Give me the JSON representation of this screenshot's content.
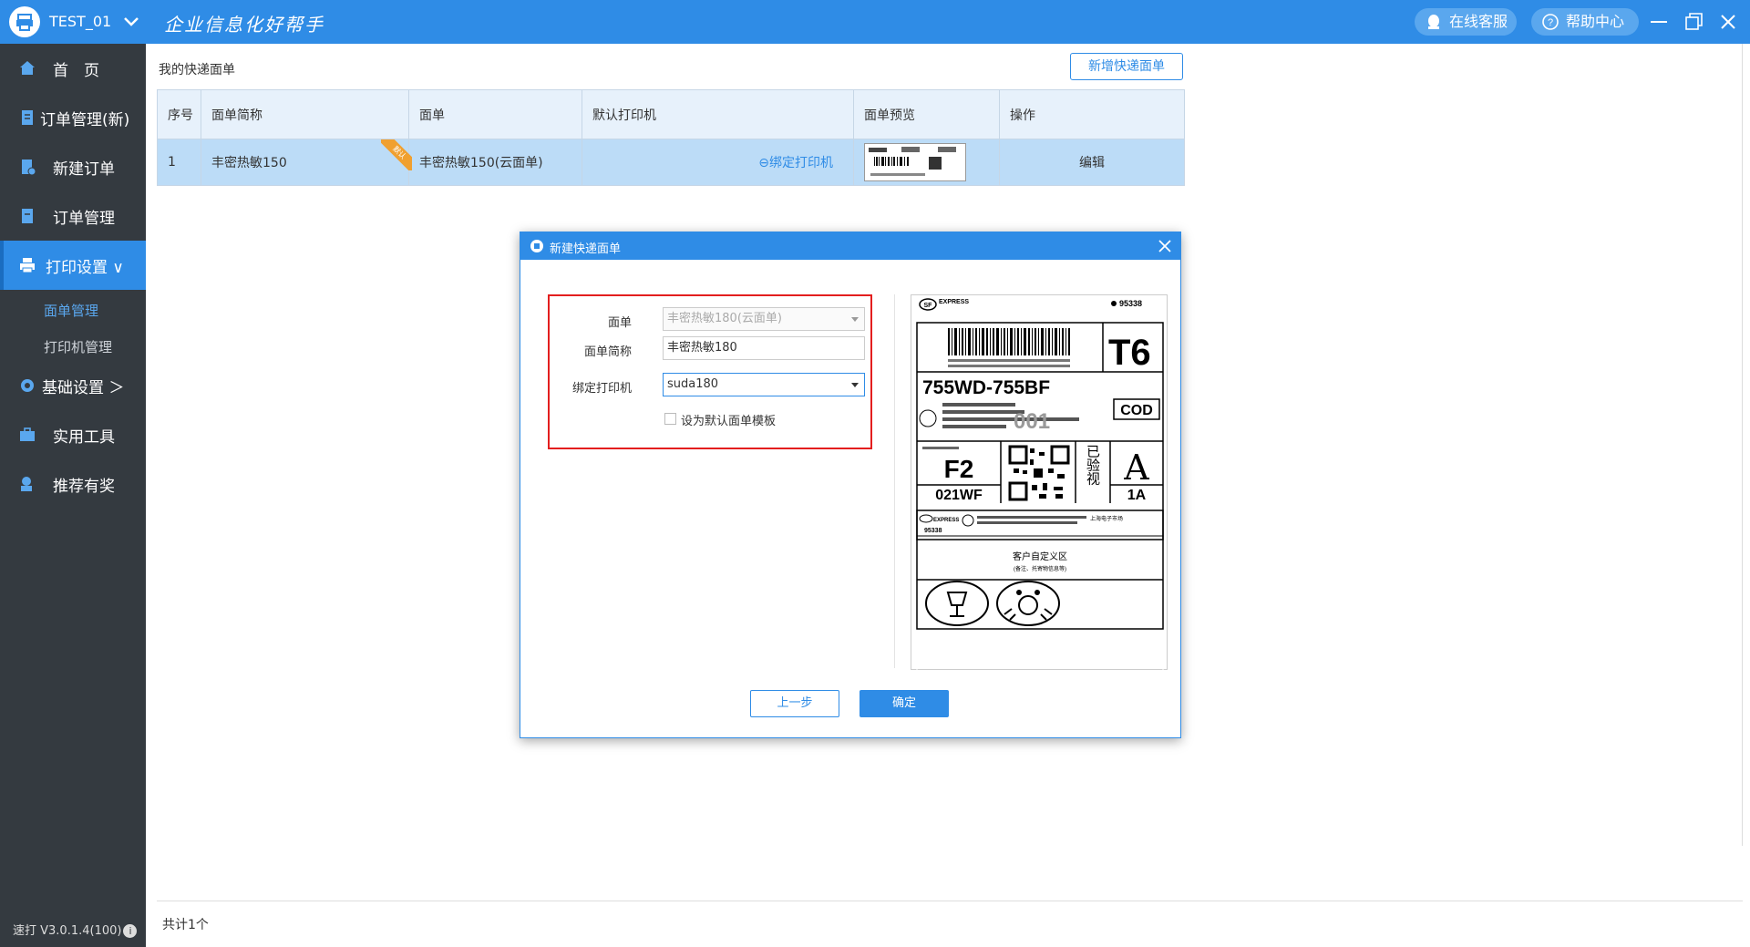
{
  "titlebar": {
    "app_name": "TEST_01",
    "slogan": "企业信息化好帮手",
    "service": "在线客服",
    "help": "帮助中心"
  },
  "sidebar": {
    "items": [
      {
        "label": "首　页",
        "icon": "home-icon"
      },
      {
        "label": "订单管理(新)",
        "icon": "order-new-icon"
      },
      {
        "label": "新建订单",
        "icon": "new-order-icon"
      },
      {
        "label": "订单管理",
        "icon": "order-icon"
      },
      {
        "label": "打印设置 ∨",
        "icon": "printer-icon"
      },
      {
        "label": "基础设置 ＞",
        "icon": "gear-icon"
      },
      {
        "label": "实用工具",
        "icon": "toolbox-icon"
      },
      {
        "label": "推荐有奖",
        "icon": "gift-user-icon"
      }
    ],
    "subitems": [
      "面单管理",
      "打印机管理"
    ],
    "version": "速打 V3.0.1.4(100)"
  },
  "main": {
    "title": "我的快递面单",
    "add_button": "新增快递面单",
    "columns": [
      "序号",
      "面单简称",
      "面单",
      "默认打印机",
      "面单预览",
      "操作"
    ],
    "rows": [
      {
        "index": "1",
        "short_name": "丰密热敏150",
        "template": "丰密热敏150(云面单)",
        "printer_link": "⊖绑定打印机",
        "action": "编辑",
        "ribbon": "默认"
      }
    ],
    "footer_count": "共计1个"
  },
  "dialog": {
    "title": "新建快递面单",
    "template_label": "面单",
    "template_value": "丰密热敏180(云面单)",
    "short_name_label": "面单简称",
    "short_name_value": "丰密热敏180",
    "printer_label": "绑定打印机",
    "printer_value": "suda180",
    "default_checkbox": "设为默认面单模板",
    "prev_button": "上一步",
    "ok_button": "确定",
    "preview": {
      "brand": "EXPRESS",
      "hotline": "95338",
      "route_code": "755WD-755BF",
      "cod": "COD",
      "t_code": "T6",
      "zone": "F2",
      "zone_sub": "021WF",
      "grade": "A",
      "grade_sub": "1A",
      "inspect": "已验视",
      "watermark": "001",
      "custom_area": "客户自定义区",
      "custom_hint": "(备注、托寄物信息等)",
      "sender_city": "上海电子市场"
    }
  },
  "colors": {
    "accent": "#2f8ce6",
    "sidebar": "#343a40",
    "highlight": "#e31e1e"
  }
}
